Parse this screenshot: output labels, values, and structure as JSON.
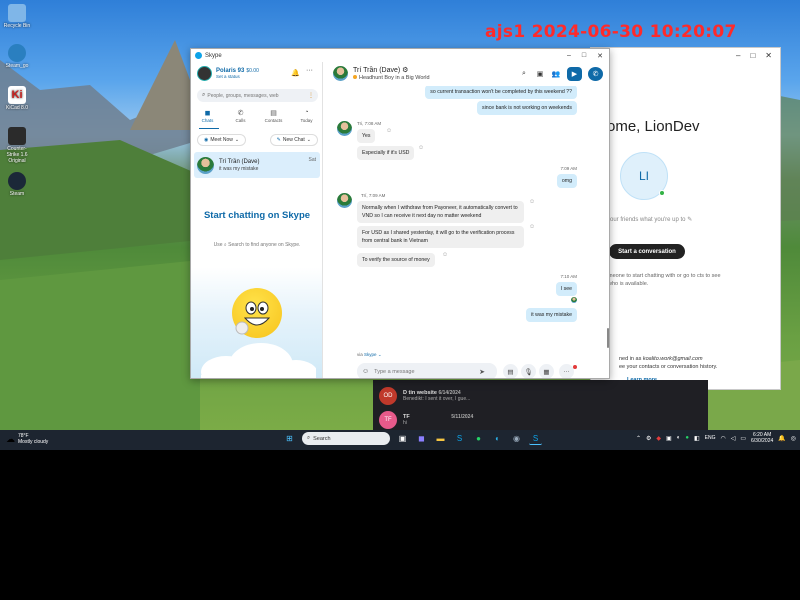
{
  "watermark": "ajs1 2024-06-30 10:20:07",
  "desktop_icons": [
    {
      "label": "Recycle Bin",
      "color": "#7fb6e8"
    },
    {
      "label": "Steam_go",
      "color": "#2a7fc0"
    },
    {
      "label": "KiCad 8.0",
      "color": "#d9d9d9"
    },
    {
      "label": "Counter-Strike 1.6 Original",
      "color": "#2b2b2b"
    },
    {
      "label": "Steam",
      "color": "#1b2838"
    }
  ],
  "back_window": {
    "controls": [
      "–",
      "□",
      "✕"
    ],
    "welcome": "ome, LionDev",
    "avatar_initials": "LI",
    "mood_placeholder": "your friends what you're up to",
    "start_button": "Start a conversation",
    "hint": "meone to start chatting with or go to cts to see who is available.",
    "signed_in_prefix": "ned in as",
    "signed_in_email": "koalito.work@gmail.com",
    "signed_in_suffix": "ee your contacts or conversation history.",
    "learn_more": "Learn more"
  },
  "dark_list": [
    {
      "initials": "OD",
      "color": "#c0392b",
      "name": "D tin website",
      "date": "6/14/2024",
      "preview": "Benedikt: I sent it over, I gue..."
    },
    {
      "initials": "TF",
      "color": "#e85a8a",
      "name": "TF",
      "date": "5/11/2024",
      "preview": "hi"
    }
  ],
  "skype": {
    "title": "Skype",
    "window_controls": [
      "–",
      "□",
      "✕"
    ],
    "profile": {
      "name": "Polaris 93",
      "balance": "$0.00",
      "status": "Set a status"
    },
    "search_placeholder": "People, groups, messages, web",
    "nav_tabs": [
      {
        "label": "Chats",
        "icon": "chat-icon",
        "glyph": "💬",
        "active": true
      },
      {
        "label": "Calls",
        "icon": "phone-icon",
        "glyph": "✆",
        "active": false
      },
      {
        "label": "Contacts",
        "icon": "contacts-icon",
        "glyph": "👤",
        "active": false
      },
      {
        "label": "Today",
        "icon": "today-icon",
        "glyph": "🔔",
        "active": false
      }
    ],
    "meet_now": "Meet Now",
    "new_chat": "New Chat",
    "chat_item": {
      "name": "Trí Trần (Dave)",
      "message": "it was my mistake",
      "day": "Sat"
    },
    "promo": {
      "title": "Start chatting on Skype",
      "use": "Use",
      "search_hint": "Search to find anyone on Skype."
    },
    "chat": {
      "name": "Trí Trần (Dave)",
      "mood": "Headhunt Boy in a Big World",
      "messages": [
        {
          "text": "so current transaction won't be completed by this weekend ??",
          "dir": "out"
        },
        {
          "text": "since bank is not working on weekends",
          "dir": "out"
        },
        {
          "meta": "Tri, 7:08 AM"
        },
        {
          "text": "Yes",
          "dir": "in"
        },
        {
          "text": "Especially if it's USD",
          "dir": "in"
        },
        {
          "meta": "7:09 AM"
        },
        {
          "text": "omg",
          "dir": "out"
        },
        {
          "meta": "Trí, 7:09 AM"
        },
        {
          "text": "Normally when I withdraw from Payoneer, it automatically convert to VND so I can receive it next day no matter weekend",
          "dir": "in"
        },
        {
          "text": "For USD as I shared yesterday, it will go to the verification process from central bank in Vietnam",
          "dir": "in"
        },
        {
          "text": "To verify the source of money",
          "dir": "in"
        },
        {
          "meta": "7:10 AM"
        },
        {
          "text": "I see",
          "dir": "out"
        },
        {
          "text": "it was my mistake",
          "dir": "out"
        }
      ],
      "via": "via",
      "via_link": "Skype",
      "composer_placeholder": "Type a message"
    }
  },
  "taskbar": {
    "weather_temp": "78°F",
    "weather_desc": "Mostly cloudy",
    "search_placeholder": "Search",
    "lang": "ENG",
    "time": "6:20 AM",
    "date": "6/30/2024"
  }
}
